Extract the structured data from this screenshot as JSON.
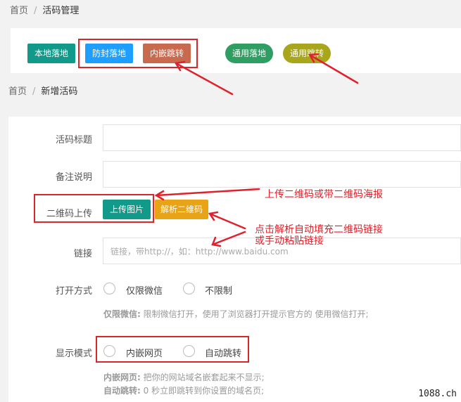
{
  "breadcrumb_top": {
    "home": "首页",
    "sep": "/",
    "current": "活码管理"
  },
  "type_buttons": [
    {
      "label": "本地落地",
      "color": "#11998a"
    },
    {
      "label": "防封落地",
      "color": "#1e9fff"
    },
    {
      "label": "内嵌跳转",
      "color": "#c9694e"
    },
    {
      "label": "通用落地",
      "color": "#2f9e62"
    },
    {
      "label": "通用跳转",
      "color": "#a8a61b"
    }
  ],
  "breadcrumb_form": {
    "home": "首页",
    "sep": "/",
    "current": "新增活码"
  },
  "form": {
    "title_label": "活码标题",
    "remark_label": "备注说明",
    "qr_label": "二维码上传",
    "upload_button": "上传图片",
    "parse_button": "解析二维码",
    "link_label": "链接",
    "link_placeholder": "链接，带http://，如：http://www.baidu.com",
    "open_label": "打开方式",
    "open_options": [
      "仅限微信",
      "不限制"
    ],
    "open_hint_title": "仅限微信:",
    "open_hint_text": " 限制微信打开，使用了浏览器打开提示官方的 使用微信打开;",
    "display_label": "显示模式",
    "display_options": [
      "内嵌网页",
      "自动跳转"
    ],
    "display_hint1_title": "内嵌网页:",
    "display_hint1_text": " 把你的网站域名嵌套起来不显示;",
    "display_hint2_title": "自动跳转:",
    "display_hint2_text": " 0 秒立即跳转到你设置的域名页;"
  },
  "annotations": {
    "upload_note": "上传二维码或带二维码海报",
    "parse_note_line1": "点击解析自动填充二维码链接",
    "parse_note_line2": "或手动粘贴链接"
  },
  "watermark": "1088.ch",
  "colors": {
    "annotation_red": "#d9262c"
  }
}
